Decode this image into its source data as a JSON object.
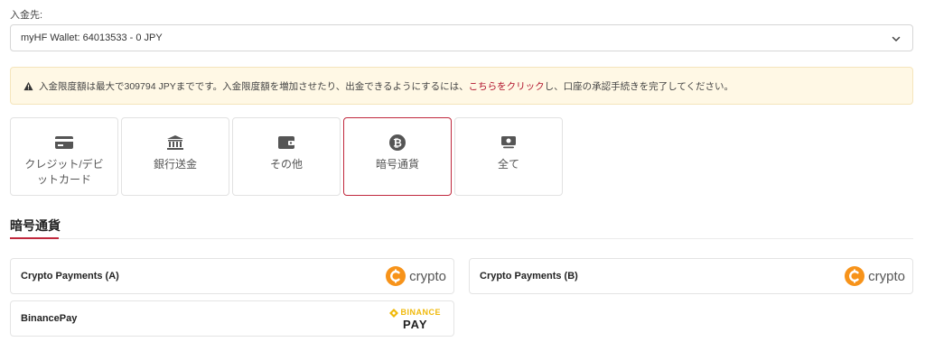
{
  "deposit_to": {
    "label": "入金先:",
    "selected": "myHF Wallet: 64013533 - 0 JPY"
  },
  "alert": {
    "text_before": "入金限度額は最大で309794 JPYまでです。入金限度額を増加させたり、出金できるようにするには、",
    "link": "こちらをクリック",
    "text_after": "し、口座の承認手続きを完了してください。"
  },
  "tabs": [
    {
      "label": "クレジット/デビットカード",
      "icon": "credit-card-icon",
      "active": false
    },
    {
      "label": "銀行送金",
      "icon": "bank-icon",
      "active": false
    },
    {
      "label": "その他",
      "icon": "wallet-icon",
      "active": false
    },
    {
      "label": "暗号通貨",
      "icon": "bitcoin-icon",
      "active": true
    },
    {
      "label": "全て",
      "icon": "money-icon",
      "active": false
    }
  ],
  "tab_labels": {
    "card_line1": "クレジット/デビ",
    "card_line2": "ットカード"
  },
  "section": {
    "title": "暗号通貨"
  },
  "payments": [
    {
      "name": "Crypto Payments (A)",
      "logo_text": "crypto"
    },
    {
      "name": "Crypto Payments (B)",
      "logo_text": "crypto"
    },
    {
      "name": "BinancePay",
      "logo_top": "BINANCE",
      "logo_bottom": "PAY"
    }
  ],
  "colors": {
    "accent": "#c0283d",
    "alert_bg": "#fff8e5",
    "crypto_orange": "#f7931a",
    "binance_yellow": "#f0b90b"
  }
}
